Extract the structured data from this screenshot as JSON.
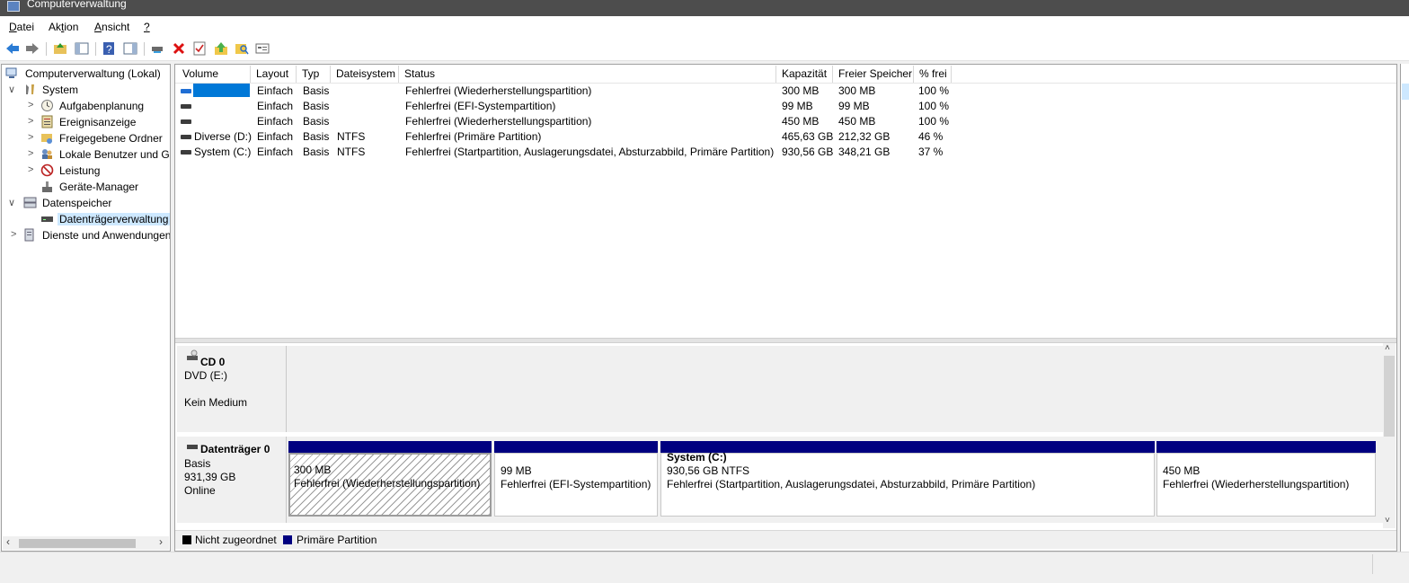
{
  "window": {
    "title": "Computerverwaltung"
  },
  "menu": {
    "file_accel": "D",
    "file_rest": "atei",
    "action_pre": "Ak",
    "action_accel": "t",
    "action_rest": "ion",
    "view_accel": "A",
    "view_rest": "nsicht",
    "help_accel": "?"
  },
  "toolbar": {
    "icons": [
      "back-arrow-icon",
      "forward-arrow-icon",
      "up-folder-icon",
      "show-hide-console-tree-icon",
      "help-icon",
      "show-hide-action-pane-icon",
      "connect-icon",
      "delete-icon",
      "properties-check-icon",
      "import-arrow-icon",
      "search-folder-icon",
      "disk-details-icon"
    ]
  },
  "tree": {
    "root": "Computerverwaltung (Lokal)",
    "system": "System",
    "task_scheduler": "Aufgabenplanung",
    "event_viewer": "Ereignisanzeige",
    "shared_folders": "Freigegebene Ordner",
    "local_users": "Lokale Benutzer und Gruppen",
    "performance": "Leistung",
    "device_manager": "Geräte-Manager",
    "storage": "Datenspeicher",
    "disk_management": "Datenträgerverwaltung",
    "services": "Dienste und Anwendungen",
    "expand_glyph": ">",
    "collapse_glyph": "∨"
  },
  "volumes": {
    "columns": [
      "Volume",
      "Layout",
      "Typ",
      "Dateisystem",
      "Status",
      "Kapazität",
      "Freier Speicher",
      "% frei"
    ],
    "rows": [
      {
        "volume": "",
        "layout": "Einfach",
        "type": "Basis",
        "fs": "",
        "status": "Fehlerfrei (Wiederherstellungspartition)",
        "capacity": "300 MB",
        "free": "300 MB",
        "pct": "100 %"
      },
      {
        "volume": "",
        "layout": "Einfach",
        "type": "Basis",
        "fs": "",
        "status": "Fehlerfrei (EFI-Systempartition)",
        "capacity": "99 MB",
        "free": "99 MB",
        "pct": "100 %"
      },
      {
        "volume": "",
        "layout": "Einfach",
        "type": "Basis",
        "fs": "",
        "status": "Fehlerfrei (Wiederherstellungspartition)",
        "capacity": "450 MB",
        "free": "450 MB",
        "pct": "100 %"
      },
      {
        "volume": "Diverse (D:)",
        "layout": "Einfach",
        "type": "Basis",
        "fs": "NTFS",
        "status": "Fehlerfrei (Primäre Partition)",
        "capacity": "465,63 GB",
        "free": "212,32 GB",
        "pct": "46 %"
      },
      {
        "volume": "System (C:)",
        "layout": "Einfach",
        "type": "Basis",
        "fs": "NTFS",
        "status": "Fehlerfrei (Startpartition, Auslagerungsdatei, Absturzabbild, Primäre Partition)",
        "capacity": "930,56 GB",
        "free": "348,21 GB",
        "pct": "37 %"
      }
    ]
  },
  "disks": {
    "cd": {
      "name": "CD 0",
      "drive": "DVD (E:)",
      "media": "Kein Medium"
    },
    "disk0": {
      "name": "Datenträger 0",
      "kind": "Basis",
      "size": "931,39 GB",
      "state": "Online",
      "partitions": [
        {
          "title": "",
          "size": "300 MB",
          "status": "Fehlerfrei (Wiederherstellungspartition)"
        },
        {
          "title": "",
          "size": "99 MB",
          "status": "Fehlerfrei (EFI-Systempartition)"
        },
        {
          "title": "System  (C:)",
          "size": "930,56 GB NTFS",
          "status": "Fehlerfrei (Startpartition, Auslagerungsdatei, Absturzabbild, Primäre Partition)"
        },
        {
          "title": "",
          "size": "450 MB",
          "status": "Fehlerfrei (Wiederherstellungspartition)"
        }
      ]
    }
  },
  "legend": {
    "unallocated": "Nicht zugeordnet",
    "primary": "Primäre Partition"
  },
  "colors": {
    "primary_partition": "#000080",
    "unallocated": "#000000",
    "selection": "#cde8ff"
  }
}
